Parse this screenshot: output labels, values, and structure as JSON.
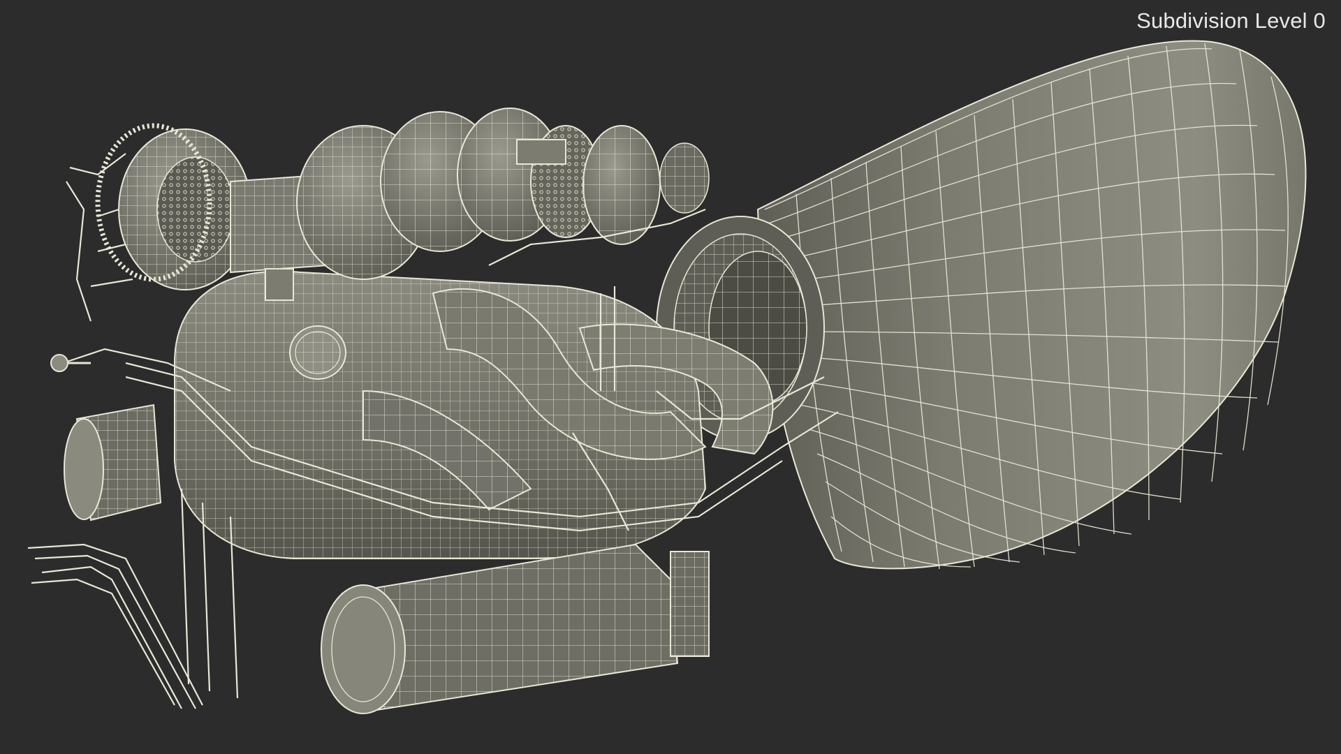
{
  "viewport": {
    "overlay_label": "Subdivision Level 0",
    "background_color": "#2c2c2c",
    "model_fill_color": "#838378",
    "wire_color": "#e9e7d6",
    "render_mode": "wireframe-on-shaded"
  }
}
